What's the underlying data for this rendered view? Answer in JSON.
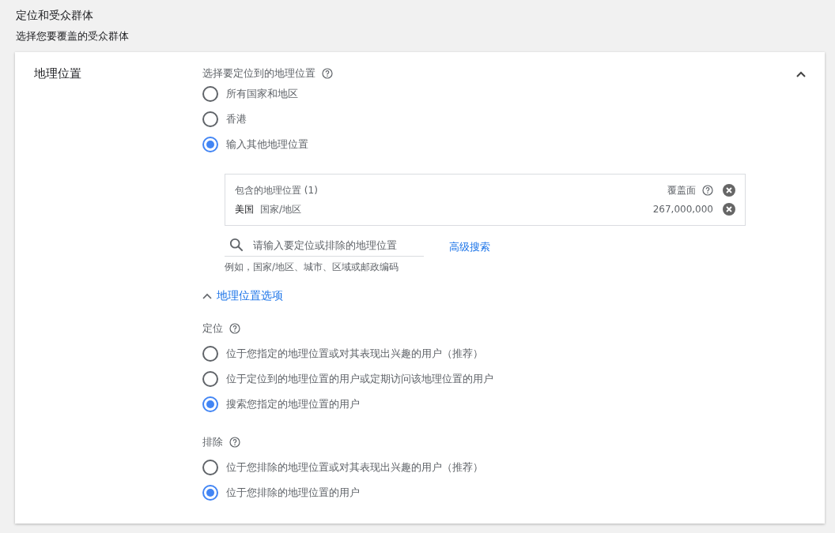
{
  "header": {
    "title": "定位和受众群体",
    "subtitle": "选择您要覆盖的受众群体"
  },
  "section": {
    "title": "地理位置",
    "expanded": true,
    "location_choice": {
      "label": "选择要定位到的地理位置",
      "options": [
        {
          "label": "所有国家和地区",
          "selected": false
        },
        {
          "label": "香港",
          "selected": false
        },
        {
          "label": "输入其他地理位置",
          "selected": true
        }
      ]
    },
    "included": {
      "heading": "包含的地理位置 (1)",
      "reach_label": "覆盖面",
      "rows": [
        {
          "name": "美国",
          "type": "国家/地区",
          "reach": "267,000,000"
        }
      ]
    },
    "search": {
      "placeholder": "请输入要定位或排除的地理位置",
      "hint": "例如，国家/地区、城市、区域或邮政编码",
      "advanced_link": "高级搜索"
    },
    "options_toggle": {
      "label": "地理位置选项",
      "expanded": true
    },
    "targeting": {
      "label": "定位",
      "options": [
        {
          "label": "位于您指定的地理位置或对其表现出兴趣的用户（推荐）",
          "selected": false
        },
        {
          "label": "位于定位到的地理位置的用户或定期访问该地理位置的用户",
          "selected": false
        },
        {
          "label": "搜索您指定的地理位置的用户",
          "selected": true
        }
      ]
    },
    "exclusion": {
      "label": "排除",
      "options": [
        {
          "label": "位于您排除的地理位置或对其表现出兴趣的用户（推荐）",
          "selected": false
        },
        {
          "label": "位于您排除的地理位置的用户",
          "selected": true
        }
      ]
    }
  }
}
